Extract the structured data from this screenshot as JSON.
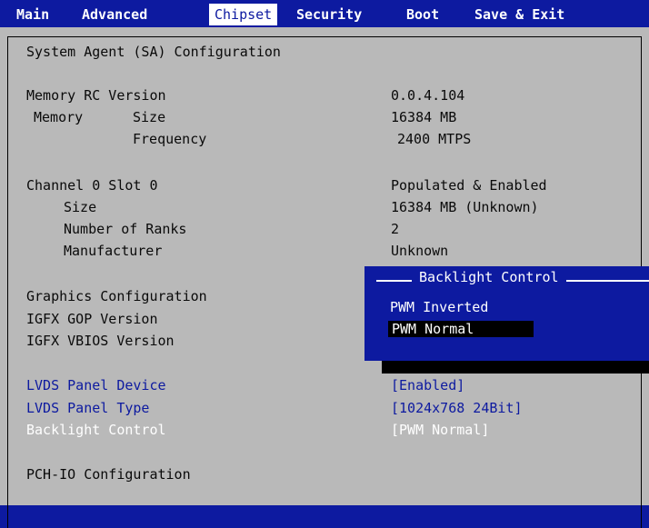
{
  "menu": {
    "tabs": [
      {
        "label": "Main"
      },
      {
        "label": "Advanced"
      },
      {
        "label": "Chipset"
      },
      {
        "label": "Security"
      },
      {
        "label": "Boot"
      },
      {
        "label": "Save & Exit"
      }
    ],
    "active_tab": "Chipset"
  },
  "page": {
    "section_title": "System Agent (SA) Configuration",
    "memory_rc_label": "Memory RC Version",
    "memory_rc_value": "0.0.4.104",
    "memory_label": "Memory",
    "size_label": "Size",
    "size_value": "16384 MB",
    "frequency_label": "Frequency",
    "frequency_value": "2400 MTPS",
    "channel_label": "Channel 0 Slot 0",
    "channel_value": "Populated & Enabled",
    "ch_size_label": "Size",
    "ch_size_value": "16384 MB (Unknown)",
    "ranks_label": "Number of Ranks",
    "ranks_value": "2",
    "manufacturer_label": "Manufacturer",
    "manufacturer_value": "Unknown",
    "graphics_label": "Graphics Configuration",
    "gop_label": "IGFX GOP Version",
    "vbios_label": "IGFX VBIOS Version",
    "lvds_device_label": "LVDS Panel Device",
    "lvds_device_value": "[Enabled]",
    "lvds_type_label": "LVDS Panel Type",
    "lvds_type_value": "[1024x768   24Bit]",
    "backlight_label": "Backlight Control",
    "backlight_value": "[PWM Normal]",
    "pch_label": "PCH-IO Configuration"
  },
  "popup": {
    "title": "Backlight Control",
    "options": [
      "PWM Inverted",
      "PWM Normal"
    ],
    "selected": "PWM Normal"
  },
  "colors": {
    "bios_blue": "#0d1aa0",
    "panel_gray": "#b9b9b9",
    "text": "#0a0a0a",
    "highlight": "#ffffff"
  }
}
